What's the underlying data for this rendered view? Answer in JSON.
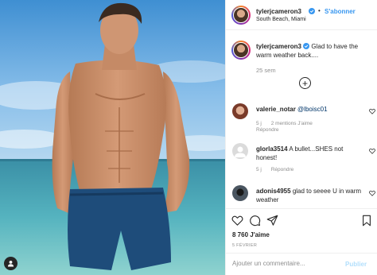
{
  "header": {
    "username": "tylerjcameron3",
    "dot": "•",
    "follow_label": "S'abonner",
    "location": "South Beach, Miami"
  },
  "caption": {
    "username": "tylerjcameron3",
    "text": "Glad to have the warm weather back....",
    "time_ago": "25 sem"
  },
  "load_more_symbol": "+",
  "comments": [
    {
      "username": "valerie_notar",
      "mention": "@lboisc01",
      "text": "",
      "time": "5 j",
      "likes": "2 mentions J'aime",
      "reply": "Répondre"
    },
    {
      "username": "glorla3514",
      "text": "A bullet...SHES not honest!",
      "time": "5 j",
      "reply": "Répondre"
    },
    {
      "username": "adonis4955",
      "text": "glad to seeee U in warm weather"
    }
  ],
  "likes_count": "8 760 J'aime",
  "date": "5 FÉVRIER",
  "add_comment": {
    "placeholder": "Ajouter un commentaire...",
    "publish_label": "Publier"
  },
  "icons": {
    "verified": "verified-badge-icon",
    "like": "heart-icon",
    "comment": "comment-bubble-icon",
    "share": "share-icon",
    "save": "bookmark-icon",
    "tag": "user-tag-icon",
    "load_more": "plus-circle-icon"
  },
  "colors": {
    "link_blue": "#3897f0",
    "verified_blue": "#3897f0",
    "muted": "#8e8e8e",
    "text": "#262626",
    "publish_disabled": "#b2dffc"
  }
}
